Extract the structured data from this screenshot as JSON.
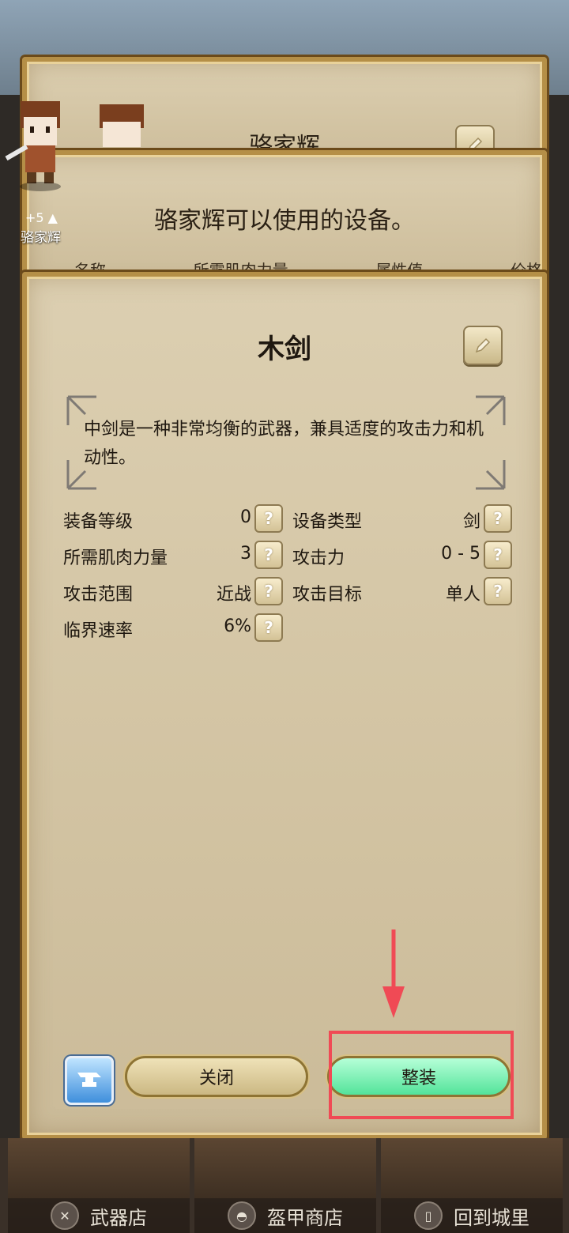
{
  "hero": {
    "level": "+5 ▲",
    "name": "骆家辉"
  },
  "panel_char": {
    "title": "骆家辉"
  },
  "panel_equipable": {
    "title": "骆家辉可以使用的设备。",
    "columns": [
      "名称",
      "所需肌肉力量",
      "属性值",
      "价格"
    ]
  },
  "item": {
    "name": "木剑",
    "description": "中剑是一种非常均衡的武器，兼具适度的攻击力和机动性。",
    "stats": [
      {
        "label": "装备等级",
        "value": "0"
      },
      {
        "label": "设备类型",
        "value": "剑"
      },
      {
        "label": "所需肌肉力量",
        "value": "3"
      },
      {
        "label": "攻击力",
        "value": "0 - 5"
      },
      {
        "label": "攻击范围",
        "value": "近战"
      },
      {
        "label": "攻击目标",
        "value": "单人"
      },
      {
        "label": "临界速率",
        "value": "6%"
      }
    ],
    "help_glyph": "?"
  },
  "buttons": {
    "close": "关闭",
    "equip": "整装"
  },
  "bottom_nav": [
    {
      "label": "武器店",
      "icon": "crossed-swords-icon"
    },
    {
      "label": "盔甲商店",
      "icon": "helmet-icon"
    },
    {
      "label": "回到城里",
      "icon": "door-icon"
    }
  ],
  "colors": {
    "highlight": "#f04a55",
    "equip_button": "#53e39a",
    "panel": "#d8c9a9"
  }
}
